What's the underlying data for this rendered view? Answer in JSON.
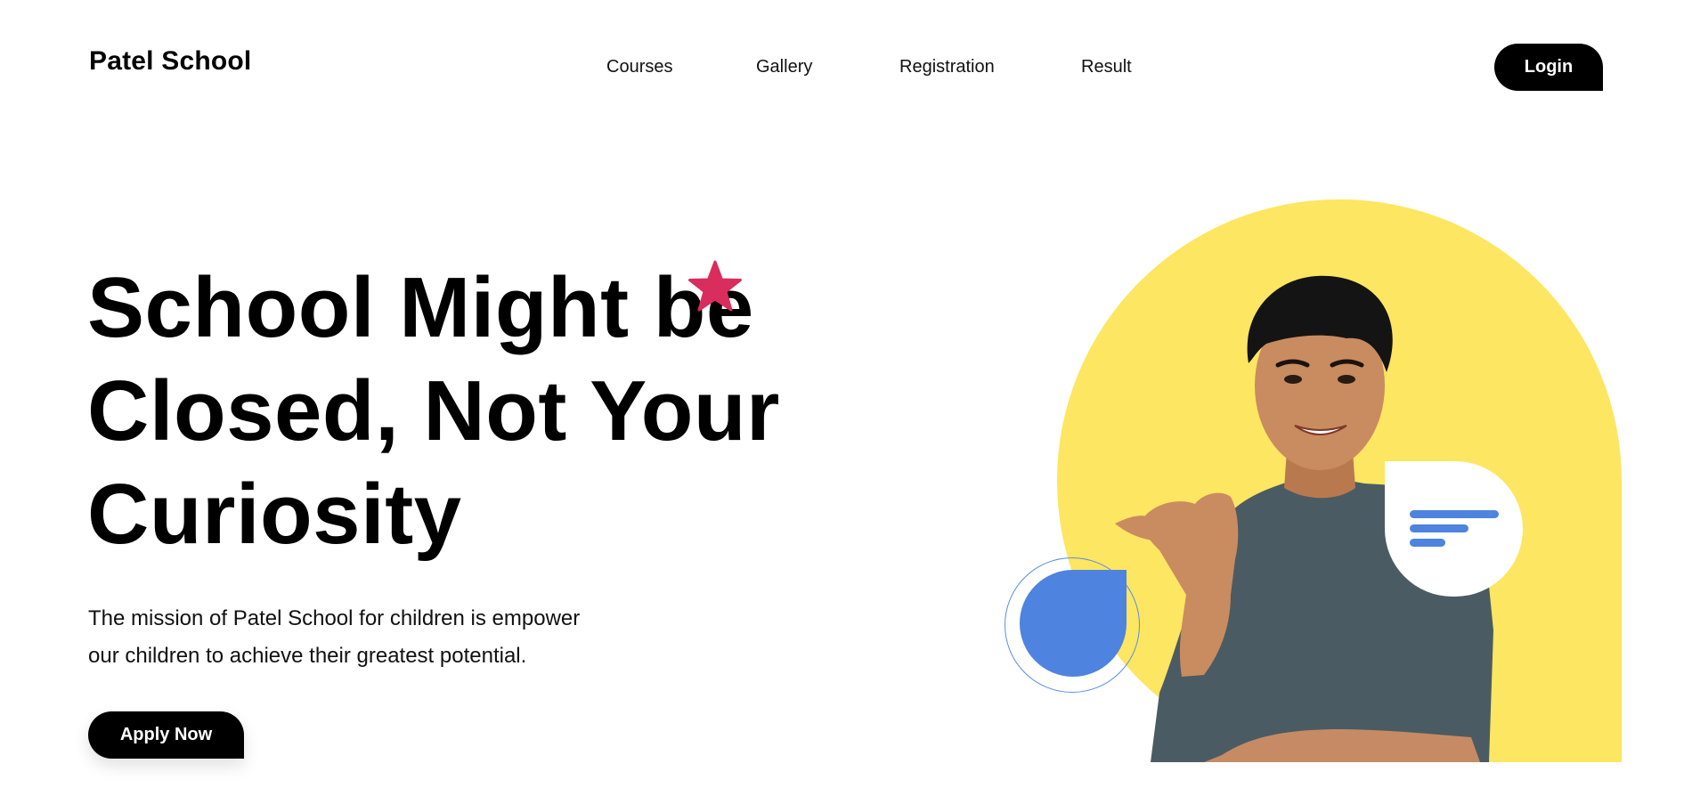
{
  "brand": {
    "name": "Patel School"
  },
  "nav": {
    "items": [
      {
        "label": "Courses"
      },
      {
        "label": "Gallery"
      },
      {
        "label": "Registration"
      },
      {
        "label": "Result"
      }
    ],
    "login_label": "Login"
  },
  "hero": {
    "title_lines": [
      "School Might be",
      "Closed, Not Your",
      "Curiosity"
    ],
    "description_lines": [
      "The mission of Patel School for children is empower",
      "our children to achieve their greatest potential."
    ],
    "cta_label": "Apply Now"
  },
  "icons": {
    "decoration": "star-icon",
    "bubble": "message-bubble-icon",
    "blob": "blue-drop-shape"
  },
  "colors": {
    "accent_yellow": "#fde661",
    "accent_blue": "#4e83df",
    "star_pink": "#d92d5d",
    "button_black": "#000000",
    "shirt": "#4b5b63"
  }
}
